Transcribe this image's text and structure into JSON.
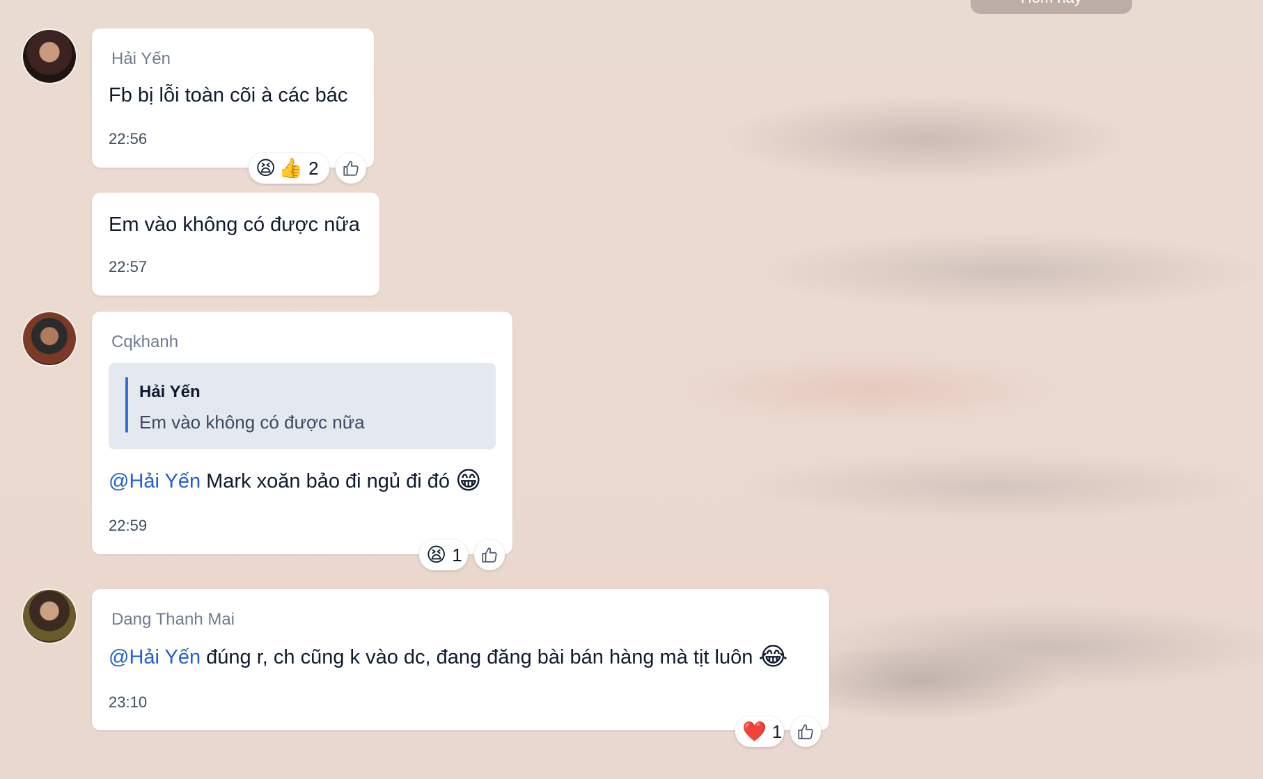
{
  "day_separator": "Hôm nay",
  "messages": [
    {
      "sender": "Hải Yến",
      "text": "Fb bị lỗi toàn cõi à các bác",
      "time": "22:56",
      "reactions": {
        "emojis": [
          "😫",
          "👍"
        ],
        "count": "2"
      }
    },
    {
      "text": "Em vào không có được nữa",
      "time": "22:57"
    },
    {
      "sender": "Cqkhanh",
      "quote": {
        "name": "Hải Yến",
        "text": "Em vào không có được nữa"
      },
      "mention": "@Hải Yến",
      "text": " Mark xoăn bảo đi ngủ đi đó",
      "emoji": "😁",
      "time": "22:59",
      "reactions": {
        "emojis": [
          "😫"
        ],
        "count": "1"
      }
    },
    {
      "sender": "Dang Thanh Mai",
      "mention": "@Hải Yến",
      "text": " đúng r, ch cũng k vào dc, đang đăng bài bán hàng mà tịt luôn",
      "emoji": "😂",
      "time": "23:10",
      "reactions": {
        "emojis": [
          "❤️"
        ],
        "count": "1"
      }
    }
  ],
  "icons": {
    "like_button": "thumbs-up-outline-icon"
  }
}
